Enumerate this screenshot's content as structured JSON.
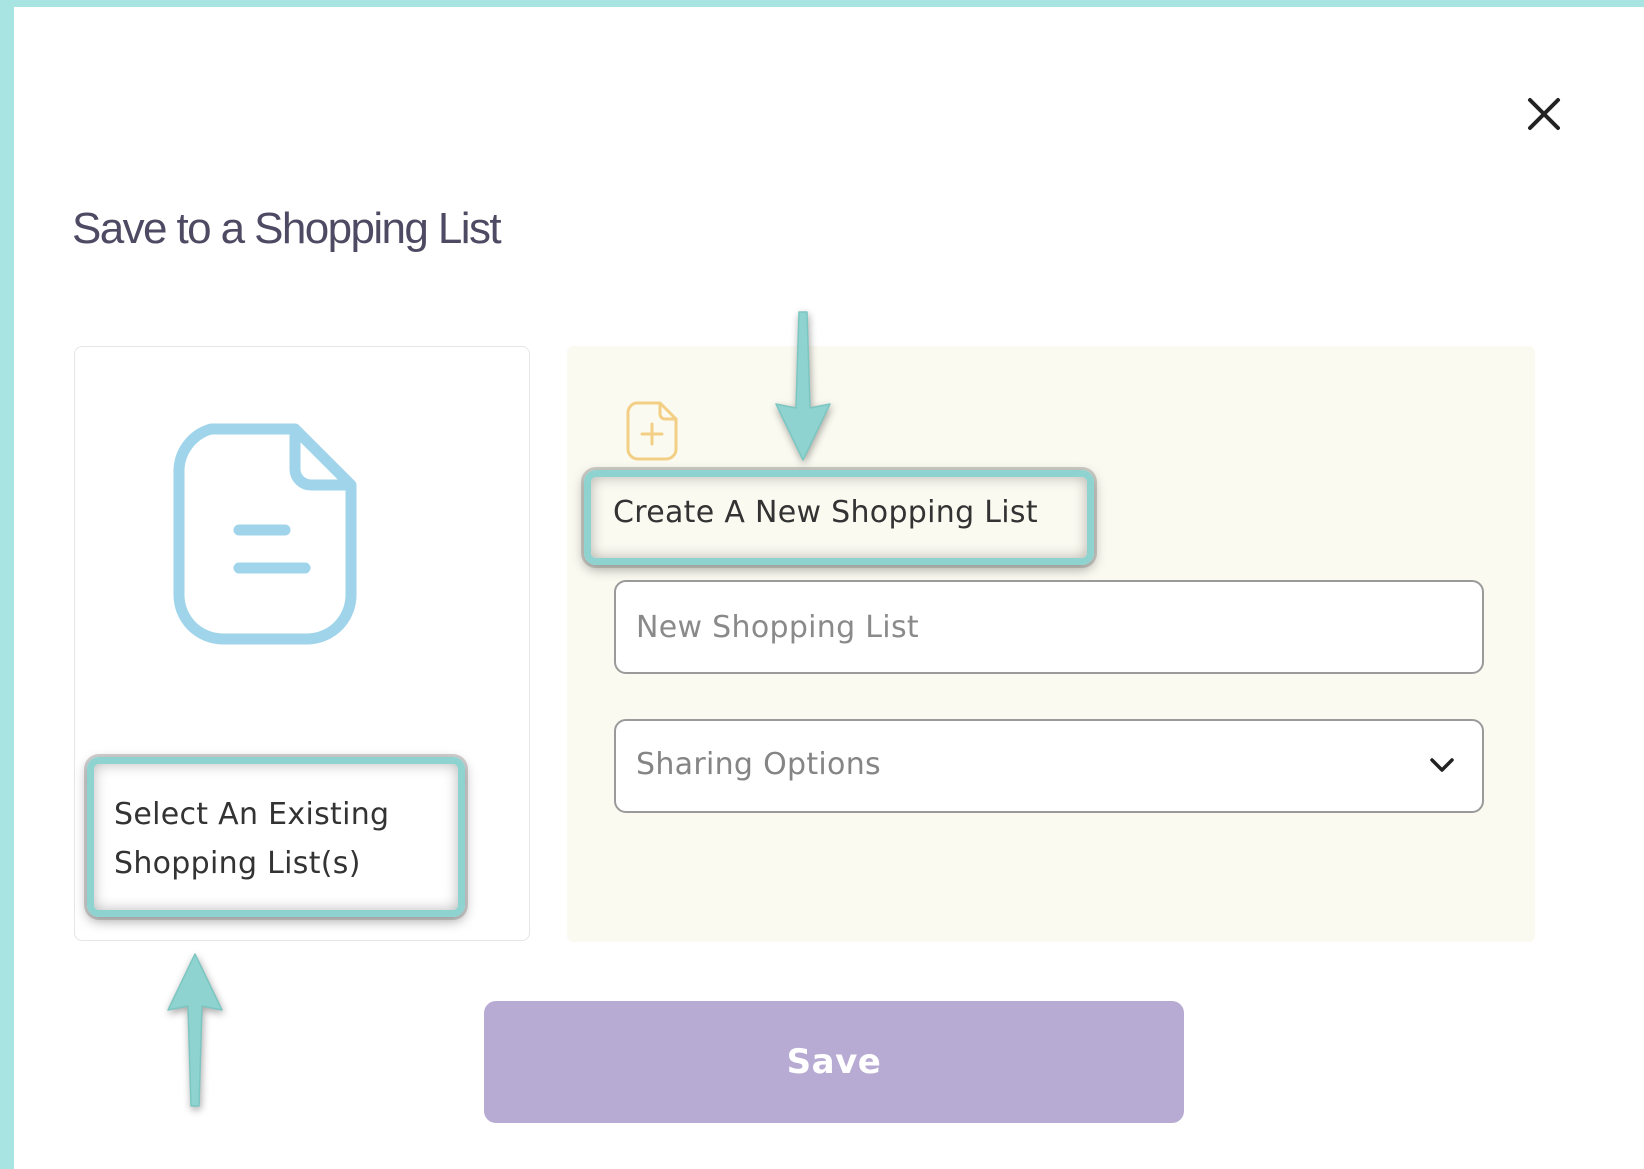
{
  "dialog": {
    "title": "Save to a Shopping List",
    "close_icon": "close-icon"
  },
  "existing_list_card": {
    "icon": "document-icon",
    "label": "Select An Existing Shopping List(s)"
  },
  "new_list_panel": {
    "icon": "add-document-icon",
    "label": "Create A New Shopping List",
    "name_input": {
      "placeholder": "New Shopping List",
      "value": ""
    },
    "sharing_select": {
      "value": "Sharing Options",
      "icon": "chevron-down-icon"
    }
  },
  "save_button": {
    "label": "Save"
  },
  "colors": {
    "frame_background": "#a8e4e2",
    "annotation_highlight": "#8fd3d0",
    "document_icon": "#9fd4ea",
    "add_icon": "#f3cf85",
    "save_button": "#b8abd3",
    "panel_background": "#fafaf1",
    "title_text": "#4f4a63"
  },
  "annotations": {
    "arrow_down_icon": "arrow-down-icon",
    "arrow_up_icon": "arrow-up-icon"
  }
}
